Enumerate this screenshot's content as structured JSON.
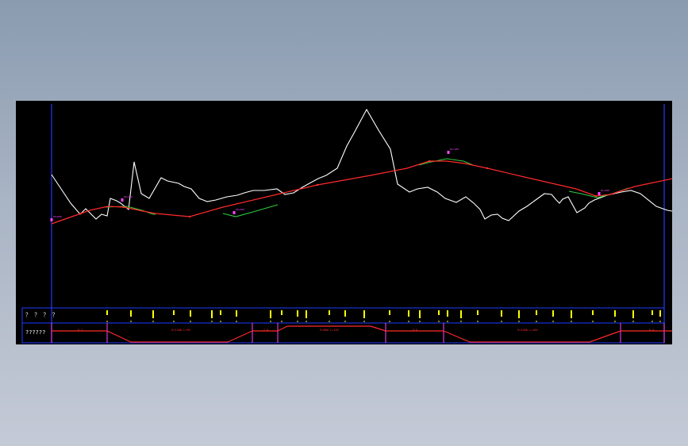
{
  "colors": {
    "background": "#000000",
    "ground_line": "#ffffff",
    "design_line": "#ff2a2a",
    "vertical_curve": "#2ecc40",
    "frame": "#1e3cff",
    "station_text": "#ffff00",
    "point_marker": "#ff44ff",
    "band_text": "#ff2a2a",
    "band_label": "#ffffff"
  },
  "band": {
    "row1_label": "？ ？ ？ ？",
    "row2_label": "??????"
  },
  "profile": {
    "ground": [
      [
        0,
        88
      ],
      [
        4,
        94
      ],
      [
        10,
        103
      ],
      [
        18,
        115
      ],
      [
        24,
        124
      ],
      [
        36,
        138
      ],
      [
        43,
        131
      ],
      [
        56,
        144
      ],
      [
        63,
        138
      ],
      [
        70,
        140
      ],
      [
        74,
        118
      ],
      [
        82,
        121
      ],
      [
        87,
        124
      ],
      [
        97,
        132
      ],
      [
        104,
        72
      ],
      [
        113,
        112
      ],
      [
        123,
        118
      ],
      [
        138,
        92
      ],
      [
        146,
        96
      ],
      [
        160,
        99
      ],
      [
        167,
        103
      ],
      [
        176,
        106
      ],
      [
        186,
        118
      ],
      [
        196,
        122
      ],
      [
        207,
        120
      ],
      [
        221,
        116
      ],
      [
        234,
        114
      ],
      [
        243,
        111
      ],
      [
        254,
        108
      ],
      [
        268,
        108
      ],
      [
        284,
        106
      ],
      [
        294,
        113
      ],
      [
        305,
        111
      ],
      [
        316,
        104
      ],
      [
        325,
        99
      ],
      [
        336,
        93
      ],
      [
        346,
        89
      ],
      [
        360,
        80
      ],
      [
        372,
        52
      ],
      [
        382,
        34
      ],
      [
        397,
        6
      ],
      [
        412,
        32
      ],
      [
        427,
        56
      ],
      [
        436,
        100
      ],
      [
        451,
        110
      ],
      [
        461,
        106
      ],
      [
        474,
        104
      ],
      [
        486,
        110
      ],
      [
        496,
        118
      ],
      [
        510,
        123
      ],
      [
        522,
        116
      ],
      [
        532,
        124
      ],
      [
        540,
        132
      ],
      [
        546,
        144
      ],
      [
        554,
        139
      ],
      [
        562,
        138
      ],
      [
        568,
        143
      ],
      [
        576,
        146
      ],
      [
        589,
        134
      ],
      [
        599,
        128
      ],
      [
        610,
        120
      ],
      [
        621,
        112
      ],
      [
        630,
        113
      ],
      [
        636,
        120
      ],
      [
        640,
        124
      ],
      [
        644,
        119
      ],
      [
        651,
        116
      ],
      [
        662,
        136
      ],
      [
        672,
        130
      ],
      [
        677,
        124
      ],
      [
        684,
        120
      ],
      [
        700,
        114
      ],
      [
        718,
        110
      ],
      [
        730,
        108
      ],
      [
        742,
        112
      ],
      [
        762,
        128
      ],
      [
        776,
        133
      ],
      [
        782,
        134
      ],
      [
        790,
        133
      ],
      [
        792,
        132
      ],
      [
        792,
        158
      ],
      [
        792,
        214
      ],
      [
        792,
        222
      ]
    ],
    "design": [
      [
        0,
        150
      ],
      [
        37,
        137
      ],
      [
        48,
        133
      ],
      [
        71,
        128
      ],
      [
        91,
        129
      ],
      [
        115,
        134
      ],
      [
        131,
        137
      ],
      [
        174,
        141
      ],
      [
        216,
        129
      ],
      [
        267,
        117
      ],
      [
        335,
        101
      ],
      [
        402,
        89
      ],
      [
        448,
        80
      ],
      [
        476,
        71
      ],
      [
        498,
        71
      ],
      [
        521,
        74
      ],
      [
        549,
        80
      ],
      [
        600,
        92
      ],
      [
        661,
        106
      ],
      [
        686,
        115
      ],
      [
        704,
        113
      ],
      [
        735,
        103
      ],
      [
        792,
        91
      ]
    ],
    "vertical_curves": [
      [
        [
          67,
          129
        ],
        [
          95,
          128
        ],
        [
          114,
          133
        ],
        [
          128,
          138
        ],
        [
          131,
          138
        ]
      ],
      [
        [
          216,
          137
        ],
        [
          232,
          141
        ],
        [
          254,
          135
        ],
        [
          285,
          126
        ]
      ],
      [
        [
          463,
          76
        ],
        [
          474,
          73
        ],
        [
          498,
          68
        ],
        [
          519,
          71
        ],
        [
          531,
          76
        ]
      ],
      [
        [
          652,
          109
        ],
        [
          667,
          112
        ],
        [
          688,
          117
        ],
        [
          707,
          112
        ],
        [
          727,
          105
        ]
      ]
    ],
    "pvi_points": [
      [
        0,
        145
      ],
      [
        89,
        120
      ],
      [
        230,
        136
      ],
      [
        500,
        60
      ],
      [
        690,
        112
      ],
      [
        792,
        88
      ]
    ],
    "pvi_station_labels": [
      "K0+000",
      "K0+200",
      "K0+500",
      "K1+100",
      "K1+500",
      "K1+740"
    ],
    "x_range": [
      0,
      792
    ],
    "y_range": [
      0,
      240
    ]
  },
  "band_stations": {
    "yellow_x": [
      70,
      100,
      128,
      154,
      175,
      202,
      213,
      233,
      276,
      290,
      310,
      321,
      350,
      370,
      394,
      426,
      450,
      464,
      488,
      499,
      516,
      537,
      567,
      589,
      611,
      632,
      655,
      682,
      710,
      733,
      757,
      767,
      792
    ],
    "pink_x": [
      0,
      70,
      253,
      285,
      421,
      494,
      717,
      772,
      792
    ],
    "red_segments": [
      [
        0,
        6,
        70,
        6
      ],
      [
        70,
        6,
        100,
        20
      ],
      [
        100,
        20,
        222,
        20
      ],
      [
        222,
        20,
        253,
        6
      ],
      [
        253,
        6,
        285,
        6
      ],
      [
        285,
        6,
        297,
        0
      ],
      [
        297,
        0,
        402,
        0
      ],
      [
        402,
        0,
        421,
        6
      ],
      [
        421,
        6,
        494,
        6
      ],
      [
        494,
        6,
        527,
        20
      ],
      [
        527,
        20,
        678,
        20
      ],
      [
        678,
        20,
        717,
        6
      ],
      [
        717,
        6,
        792,
        6
      ]
    ],
    "segment_labels": [
      {
        "x": 36,
        "text": "0.3"
      },
      {
        "x": 163,
        "text": "R=1200 L=90"
      },
      {
        "x": 270,
        "text": "1.0"
      },
      {
        "x": 350,
        "text": "R=800 L=120"
      },
      {
        "x": 458,
        "text": "0.6"
      },
      {
        "x": 600,
        "text": "R=1500 L=160"
      },
      {
        "x": 756,
        "text": "0.4"
      }
    ]
  }
}
